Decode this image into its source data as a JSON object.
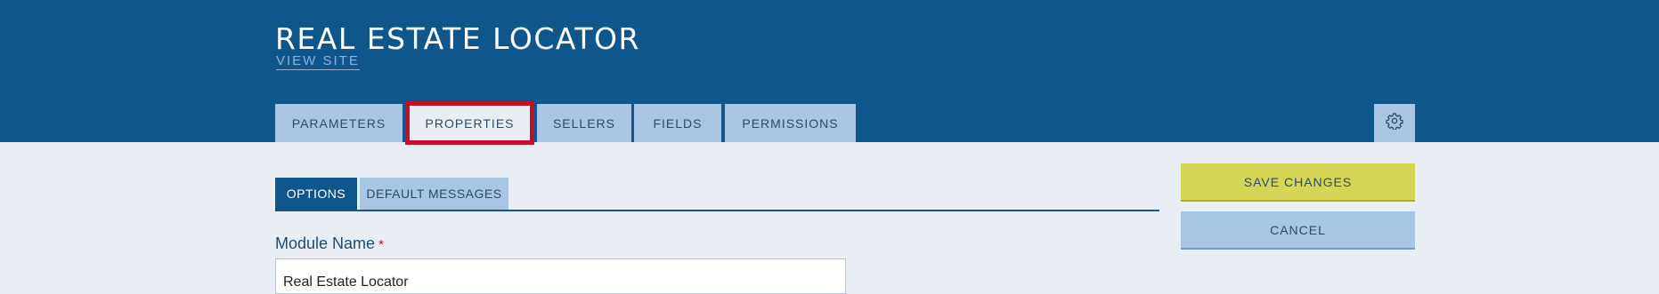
{
  "header": {
    "title": "REAL ESTATE LOCATOR",
    "view_site_label": "VIEW SITE"
  },
  "main_tabs": [
    {
      "label": "PARAMETERS",
      "active": false
    },
    {
      "label": "PROPERTIES",
      "active": true
    },
    {
      "label": "SELLERS",
      "active": false
    },
    {
      "label": "FIELDS",
      "active": false
    },
    {
      "label": "PERMISSIONS",
      "active": false
    }
  ],
  "settings_icon": "gear-icon",
  "sub_tabs": [
    {
      "label": "OPTIONS",
      "active": true
    },
    {
      "label": "DEFAULT MESSAGES",
      "active": false
    }
  ],
  "form": {
    "module_name_label": "Module Name",
    "required_marker": "*",
    "module_name_value": "Real Estate Locator"
  },
  "actions": {
    "save_label": "SAVE CHANGES",
    "cancel_label": "CANCEL"
  },
  "colors": {
    "header_bg": "#0e568b",
    "tab_bg": "#a8c6e4",
    "highlight_border": "#c0102c",
    "save_bg": "#d5d657",
    "page_bg": "#e8eef4"
  }
}
